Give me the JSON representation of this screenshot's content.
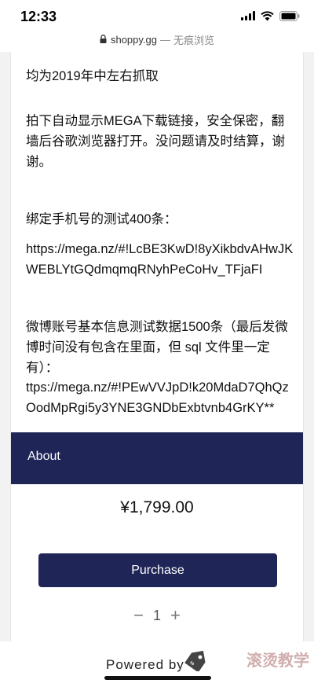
{
  "status_bar": {
    "time": "12:33"
  },
  "url_bar": {
    "domain": "shoppy.gg",
    "separator": "—",
    "mode": "无痕浏览"
  },
  "content": {
    "paragraph1": "均为2019年中左右抓取",
    "paragraph2": "拍下自动显示MEGA下载链接，安全保密，翻墙后谷歌浏览器打开。没问题请及时结算，谢谢。",
    "paragraph3": "绑定手机号的测试400条：",
    "paragraph4": "https://mega.nz/#!LcBE3KwD!8yXikbdvAHwJKWEBLYtGQdmqmqRNyhPeCoHv_TFjaFI",
    "paragraph5": "微博账号基本信息测试数据1500条（最后发微博时间没有包含在里面，但 sql 文件里一定有）：",
    "paragraph6": "ttps://mega.nz/#!PEwVVJpD!k20MdaD7QhQzOodMpRgi5y3YNE3GNDbExbtvnb4GrKY**"
  },
  "about": {
    "label": "About"
  },
  "product": {
    "price": "¥1,799.00",
    "purchase_label": "Purchase",
    "quantity": "1",
    "decrement_label": "−",
    "increment_label": "+"
  },
  "footer": {
    "powered_label": "Powered by",
    "watermark": "滚烫教学"
  },
  "colors": {
    "accent": "#1f2557"
  }
}
